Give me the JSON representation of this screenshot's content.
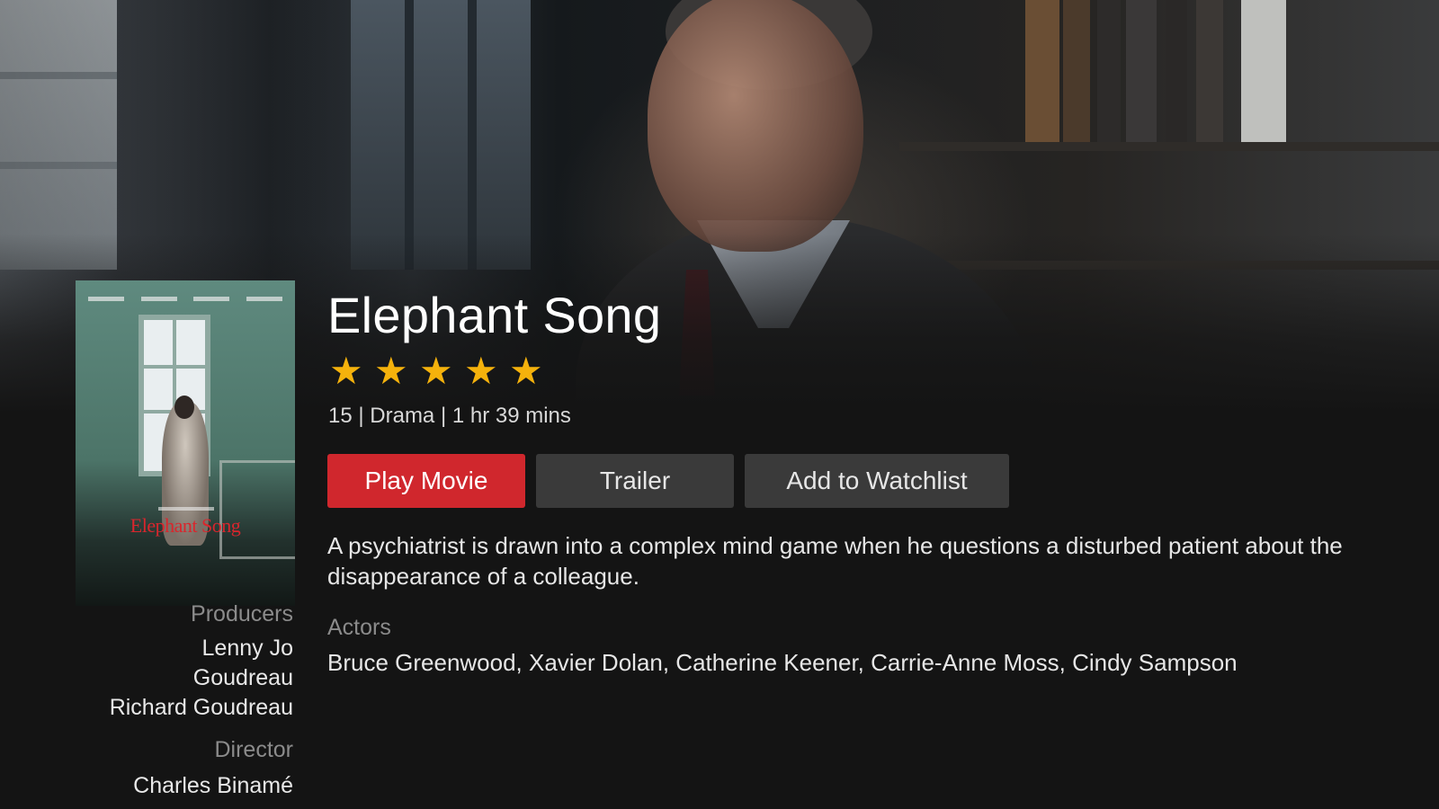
{
  "movie": {
    "title": "Elephant Song",
    "rating_stars": 5,
    "star_glyph": "★",
    "meta": "15 | Drama | 1 hr 39 mins",
    "synopsis": "A psychiatrist is drawn into a complex mind game when he questions a disturbed patient about the disappearance of a colleague.",
    "poster_title": "Elephant Song"
  },
  "buttons": {
    "play": "Play Movie",
    "trailer": "Trailer",
    "watchlist": "Add to Watchlist"
  },
  "cast": {
    "actors_label": "Actors",
    "actors": "Bruce Greenwood, Xavier Dolan, Catherine Keener, Carrie-Anne Moss, Cindy Sampson"
  },
  "credits": {
    "producers_label": "Producers",
    "producer_1_line1": "Lenny Jo",
    "producer_1_line2": "Goudreau",
    "producer_2": "Richard Goudreau",
    "director_label": "Director",
    "director": "Charles Binamé"
  },
  "colors": {
    "accent": "#d0272d",
    "star": "#f5b20c",
    "background": "#141414",
    "button_secondary": "#3a3a3a"
  }
}
